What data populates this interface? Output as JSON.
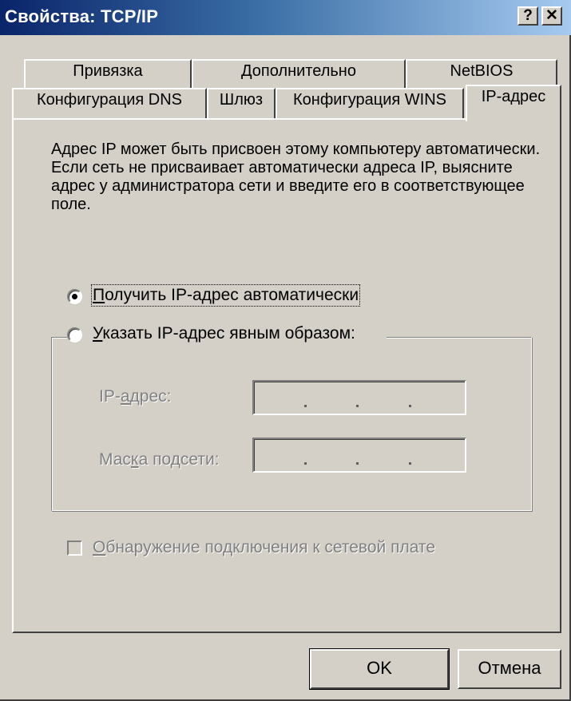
{
  "window": {
    "title": "Свойства: TCP/IP",
    "help_button": "?",
    "close_button": "✕"
  },
  "tabs": {
    "back_row": [
      "Привязка",
      "Дополнительно",
      "NetBIOS"
    ],
    "front_row": [
      "Конфигурация DNS",
      "Шлюз",
      "Конфигурация WINS",
      "IP-адрес"
    ],
    "active": "IP-адрес"
  },
  "panel": {
    "description": "Адрес IP может быть присвоен этому компьютеру автоматически. Если сеть не присваивает автоматически адреса IP, выясните адрес у администратора сети и введите его в соответствующее поле.",
    "radio_auto": {
      "label_key": "П",
      "label_rest": "олучить IP-адрес автоматически",
      "selected": true
    },
    "radio_manual": {
      "label_key": "У",
      "label_rest": "казать IP-адрес явным образом:",
      "selected": false
    },
    "ip_address": {
      "label_pre": "IP-",
      "label_key": "а",
      "label_rest": "дрес:",
      "value": ""
    },
    "subnet_mask": {
      "label_pre": "Мас",
      "label_key": "к",
      "label_rest": "а подсети:",
      "value": ""
    },
    "checkbox": {
      "label_key": "О",
      "label_rest": "бнаружение подключения к сетевой плате",
      "checked": false,
      "enabled": false
    }
  },
  "buttons": {
    "ok": "OK",
    "cancel": "Отмена"
  }
}
